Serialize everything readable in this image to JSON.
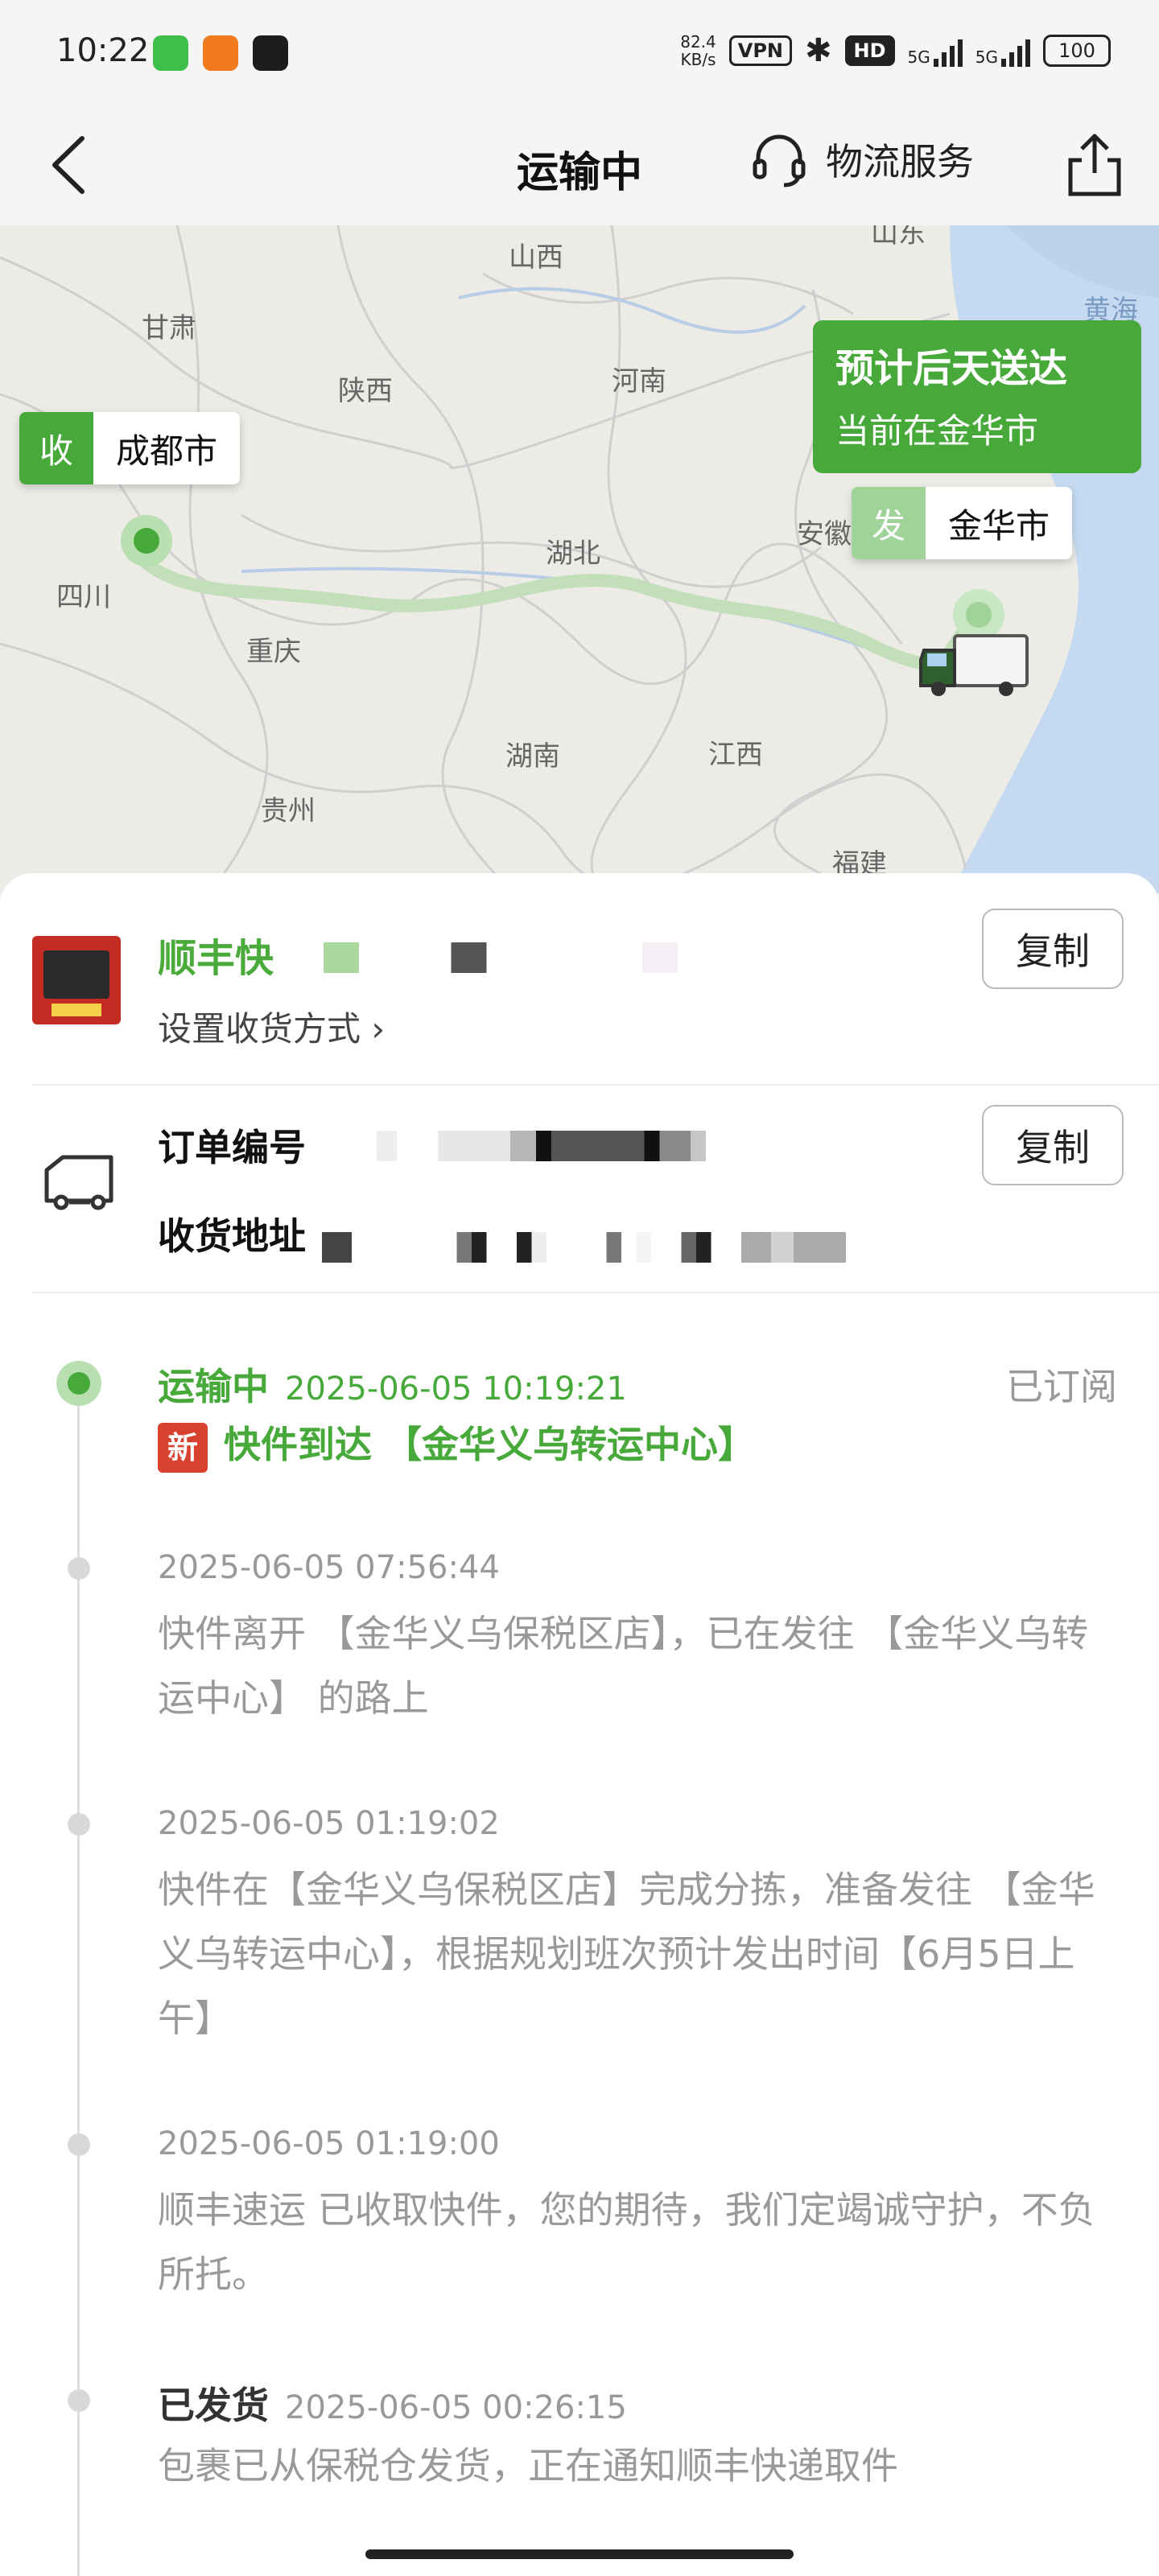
{
  "status_bar": {
    "time": "10:22",
    "net_speed_value": "82.4",
    "net_speed_unit": "KB/s",
    "vpn": "VPN",
    "hd": "HD",
    "signal1": "5G",
    "signal2": "5G",
    "battery": "100"
  },
  "nav": {
    "title": "运输中",
    "service_label": "物流服务"
  },
  "map": {
    "provinces": {
      "shanxi": "山西",
      "gansu": "甘肃",
      "shaanxi": "陕西",
      "henan": "河南",
      "sichuan": "四川",
      "hubei": "湖北",
      "anhui": "安徽",
      "chongqing": "重庆",
      "hunan": "湖南",
      "jiangxi": "江西",
      "guizhou": "贵州",
      "fujian": "福建",
      "shandong": "山东",
      "yellow_sea": "黄海"
    },
    "destination": {
      "tag": "收",
      "city": "成都市"
    },
    "origin": {
      "tag": "发",
      "city": "金华市"
    },
    "eta": {
      "line1": "预计后天送达",
      "line2": "当前在金华市"
    }
  },
  "carrier": {
    "name": "顺丰快",
    "set_receive_mode": "设置收货方式",
    "copy_label": "复制"
  },
  "order": {
    "order_no_label": "订单编号",
    "address_label": "收货地址",
    "copy_label": "复制"
  },
  "timeline": [
    {
      "status": "运输中",
      "time": "2025-06-05 10:19:21",
      "subscribed": "已订阅",
      "new_tag": "新",
      "text": "快件到达 【金华义乌转运中心】"
    },
    {
      "time": "2025-06-05 07:56:44",
      "text": "快件离开 【金华义乌保税区店】，已在发往 【金华义乌转运中心】 的路上"
    },
    {
      "time": "2025-06-05 01:19:02",
      "text": "快件在【金华义乌保税区店】完成分拣，准备发往 【金华义乌转运中心】，根据规划班次预计发出时间【6月5日上午】"
    },
    {
      "time": "2025-06-05 01:19:00",
      "text": "顺丰速运 已收取快件，您的期待，我们定竭诚守护，不负所托。"
    },
    {
      "status": "已发货",
      "time": "2025-06-05 00:26:15",
      "text": "包裹已从保税仓发货，正在通知顺丰快递取件"
    }
  ],
  "colors": {
    "brand_green": "#48a93b",
    "new_tag_red": "#d9412f",
    "route_green": "#b9d9b0"
  }
}
